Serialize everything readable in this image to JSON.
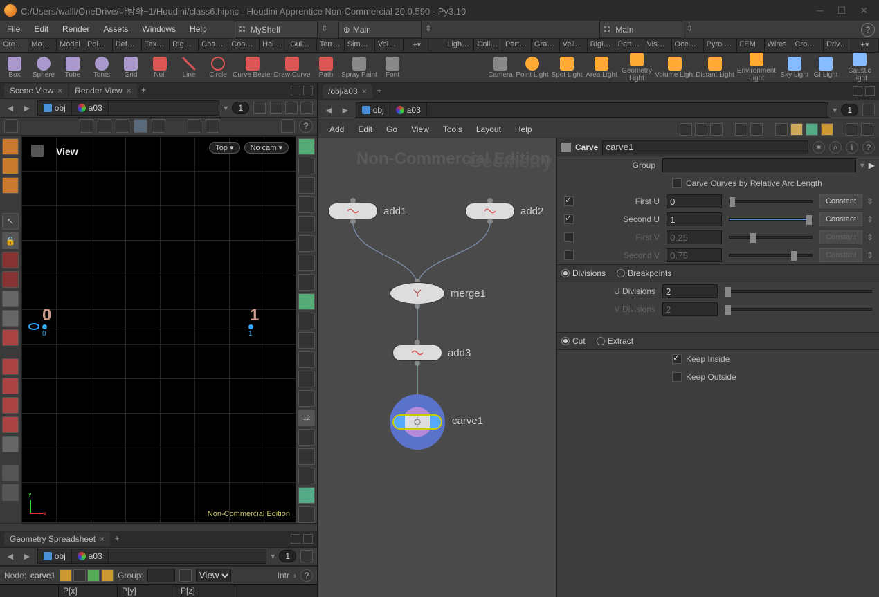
{
  "title": "C:/Users/walll/OneDrive/바탕화~1/Houdini/class6.hipnc - Houdini Apprentice Non-Commercial 20.0.590 - Py3.10",
  "menubar": {
    "items": [
      "File",
      "Edit",
      "Render",
      "Assets",
      "Windows",
      "Help"
    ]
  },
  "shelf1": {
    "label": "MyShelf"
  },
  "shelf2": {
    "label": "Main"
  },
  "shelf3": {
    "label": "Main"
  },
  "tabsL": [
    "Create",
    "Modify",
    "Model",
    "Poly…",
    "Defo…",
    "Text…",
    "Rigg…",
    "Char…",
    "Cons…",
    "Hair…",
    "Guid…",
    "Terr…",
    "Simp…",
    "Volu…"
  ],
  "tabsR": [
    "Light…",
    "Colli…",
    "Parti…",
    "Grains",
    "Vell…",
    "Rigi…",
    "Parti…",
    "Visc…",
    "Oceans",
    "Pyro FX",
    "FEM",
    "Wires",
    "Crowds",
    "Driv…"
  ],
  "shelfItemsL": [
    "Box",
    "Sphere",
    "Tube",
    "Torus",
    "Grid",
    "Null",
    "Line",
    "Circle",
    "Curve Bezier",
    "Draw Curve",
    "Path",
    "Spray Paint",
    "Font"
  ],
  "shelfItemsR": [
    "Camera",
    "Point Light",
    "Spot Light",
    "Area Light",
    "Geometry Light",
    "Volume Light",
    "Distant Light",
    "Environment Light",
    "Sky Light",
    "GI Light",
    "Caustic Light"
  ],
  "leftPane": {
    "tabs": [
      "Scene View",
      "Render View"
    ],
    "path": {
      "root": "obj",
      "sub": "a03"
    },
    "pill": "1",
    "viewport": {
      "label": "View",
      "top": "Top",
      "cam": "No cam",
      "pt0": {
        "num": "0",
        "idx": "0"
      },
      "pt1": {
        "num": "1",
        "idx": "1"
      },
      "footer": "Non-Commercial Edition"
    }
  },
  "sheet": {
    "tab": "Geometry Spreadsheet",
    "path": {
      "root": "obj",
      "sub": "a03"
    },
    "pill": "1",
    "nodeLabel": "Node:",
    "node": "carve1",
    "groupLabel": "Group:",
    "view": "View",
    "intr": "Intr",
    "cols": [
      "",
      "P[x]",
      "P[y]",
      "P[z]"
    ]
  },
  "network": {
    "tab": "/obj/a03",
    "menu": [
      "Add",
      "Edit",
      "Go",
      "View",
      "Tools",
      "Layout",
      "Help"
    ],
    "water1": "Non-Commercial Edition",
    "water2": "Geometry",
    "nodes": {
      "add1": "add1",
      "add2": "add2",
      "merge1": "merge1",
      "add3": "add3",
      "carve1": "carve1"
    }
  },
  "params": {
    "op": "Carve",
    "name": "carve1",
    "groupLabel": "Group",
    "relArc": "Carve Curves by Relative Arc Length",
    "firstU": {
      "label": "First U",
      "val": "0",
      "btn": "Constant"
    },
    "secondU": {
      "label": "Second U",
      "val": "1",
      "btn": "Constant"
    },
    "firstV": {
      "label": "First V",
      "val": "0.25",
      "btn": "Constant"
    },
    "secondV": {
      "label": "Second V",
      "val": "0.75",
      "btn": "Constant"
    },
    "tabs1": {
      "a": "Divisions",
      "b": "Breakpoints"
    },
    "udiv": {
      "label": "U Divisions",
      "val": "2"
    },
    "vdiv": {
      "label": "V Divisions",
      "val": "2"
    },
    "tabs2": {
      "a": "Cut",
      "b": "Extract"
    },
    "keepIn": "Keep Inside",
    "keepOut": "Keep Outside"
  }
}
